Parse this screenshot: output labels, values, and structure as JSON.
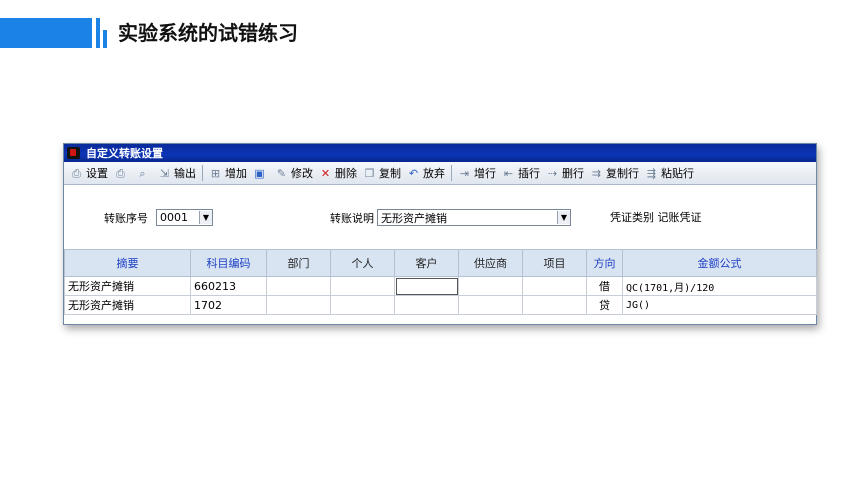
{
  "slide": {
    "title": "实验系统的试错练习"
  },
  "window": {
    "title": "自定义转账设置"
  },
  "toolbar": [
    {
      "label": "设置",
      "icon": "printer-setup-icon"
    },
    {
      "label": "",
      "icon": "print-icon"
    },
    {
      "label": "",
      "icon": "preview-icon"
    },
    {
      "label": "输出",
      "icon": "export-icon"
    },
    {
      "label": "增加",
      "icon": "add-icon"
    },
    {
      "label": "",
      "icon": "save-icon"
    },
    {
      "label": "修改",
      "icon": "edit-icon"
    },
    {
      "label": "删除",
      "icon": "delete-icon"
    },
    {
      "label": "复制",
      "icon": "copy-icon"
    },
    {
      "label": "放弃",
      "icon": "undo-icon"
    },
    {
      "label": "增行",
      "icon": "add-row-icon"
    },
    {
      "label": "插行",
      "icon": "insert-row-icon"
    },
    {
      "label": "删行",
      "icon": "delete-row-icon"
    },
    {
      "label": "复制行",
      "icon": "copy-row-icon"
    },
    {
      "label": "粘贴行",
      "icon": "paste-row-icon"
    }
  ],
  "form": {
    "seq_label": "转账序号",
    "seq_value": "0001",
    "desc_label": "转账说明",
    "desc_value": "无形资产摊销",
    "voucher_type": "凭证类别 记账凭证"
  },
  "table": {
    "headers": [
      "摘要",
      "科目编码",
      "部门",
      "个人",
      "客户",
      "供应商",
      "项目",
      "方向",
      "金额公式"
    ],
    "rows": [
      [
        "无形资产摊销",
        "660213",
        "",
        "",
        "",
        "",
        "",
        "借",
        "QC(1701,月)/120"
      ],
      [
        "无形资产摊销",
        "1702",
        "",
        "",
        "",
        "",
        "",
        "贷",
        "JG()"
      ]
    ]
  }
}
